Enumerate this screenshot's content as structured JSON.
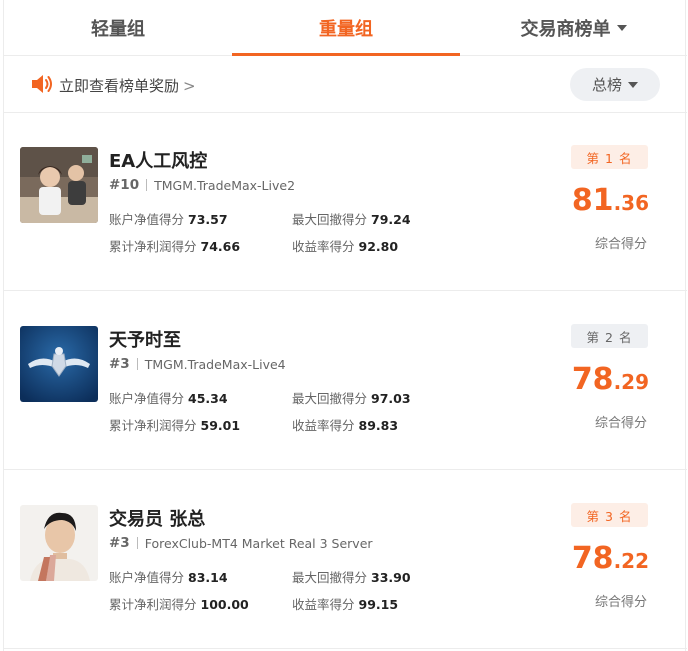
{
  "tabs": [
    {
      "label": "轻量组",
      "active": false
    },
    {
      "label": "重量组",
      "active": true
    },
    {
      "label": "交易商榜单",
      "active": false
    }
  ],
  "notice": {
    "text": "立即查看榜单奖励",
    "chevron": ">"
  },
  "board_filter": {
    "label": "总榜"
  },
  "icons": {
    "speaker": "speaker-icon",
    "dropdown": "caret-down-icon"
  },
  "colors": {
    "accent": "#f26522",
    "gold_badge_bg": "#fdeee6",
    "grey_badge_bg": "#eef0f3"
  },
  "entries": [
    {
      "name": "EA人工风控",
      "rank_tag": "#10",
      "server": "TMGM.TradeMax-Live2",
      "stats": [
        {
          "label": "账户净值得分",
          "value": "73.57"
        },
        {
          "label": "最大回撤得分",
          "value": "79.24"
        },
        {
          "label": "累计净利润得分",
          "value": "74.66"
        },
        {
          "label": "收益率得分",
          "value": "92.80"
        }
      ],
      "place": "第 1 名",
      "score_int": "81",
      "score_dec": ".36",
      "score_label": "综合得分"
    },
    {
      "name": "天予时至",
      "rank_tag": "#3",
      "server": "TMGM.TradeMax-Live4",
      "stats": [
        {
          "label": "账户净值得分",
          "value": "45.34"
        },
        {
          "label": "最大回撤得分",
          "value": "97.03"
        },
        {
          "label": "累计净利润得分",
          "value": "59.01"
        },
        {
          "label": "收益率得分",
          "value": "89.83"
        }
      ],
      "place": "第 2 名",
      "score_int": "78",
      "score_dec": ".29",
      "score_label": "综合得分"
    },
    {
      "name": "交易员 张总",
      "rank_tag": "#3",
      "server": "ForexClub-MT4 Market Real 3 Server",
      "stats": [
        {
          "label": "账户净值得分",
          "value": "83.14"
        },
        {
          "label": "最大回撤得分",
          "value": "33.90"
        },
        {
          "label": "累计净利润得分",
          "value": "100.00"
        },
        {
          "label": "收益率得分",
          "value": "99.15"
        }
      ],
      "place": "第 3 名",
      "score_int": "78",
      "score_dec": ".22",
      "score_label": "综合得分"
    }
  ]
}
